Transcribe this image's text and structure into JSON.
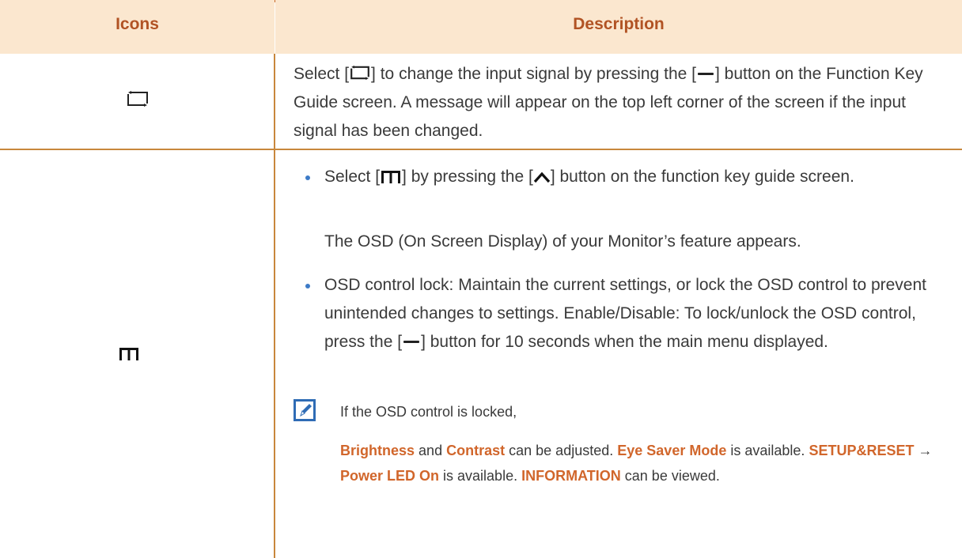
{
  "table": {
    "headers": {
      "icons": "Icons",
      "description": "Description"
    },
    "row1": {
      "icon": "input-source-icon",
      "text_part1": "Select [",
      "text_part2": "] to change the input signal by pressing the [",
      "text_part3": "] button on the Function Key Guide screen. A message will appear on the top left corner of the screen if the input signal has been changed."
    },
    "row2": {
      "icon": "menu-icon",
      "bullet1_part1": "Select [",
      "bullet1_part2": "] by pressing the [",
      "bullet1_part3": "] button on the function key guide screen.",
      "para": "The OSD (On Screen Display) of your Monitor’s feature appears.",
      "bullet2_part1": "OSD control lock: Maintain the current settings, or lock the OSD control to prevent unintended changes to settings. Enable/Disable: To lock/unlock the OSD control, press the [",
      "bullet2_part2": "] button for 10 seconds when the main menu displayed.",
      "note_intro": "If the OSD control is locked,",
      "note": {
        "brightness": "Brightness",
        "and": "and",
        "contrast": "Contrast",
        "can_adjusted": "can be adjusted.",
        "eye_saver": "Eye Saver Mode",
        "is_available1": "is available.",
        "setup_reset": "SETUP&RESET",
        "arrow": "→",
        "power_led": "Power LED On",
        "is_available2": "is available.",
        "information": "INFORMATION",
        "can_viewed": "can be viewed."
      }
    }
  },
  "colors": {
    "header_bg": "#fbe7cf",
    "header_text": "#b15324",
    "rule": "#c8873c",
    "highlight": "#d1662b",
    "bullet": "#3d7bc7"
  }
}
